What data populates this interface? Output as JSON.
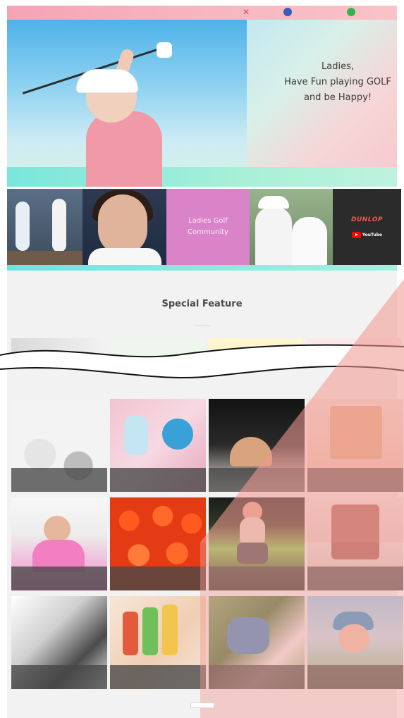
{
  "topbar": {
    "logo": "",
    "social": [
      {
        "name": "X",
        "label": ""
      },
      {
        "name": "Facebook",
        "label": ""
      },
      {
        "name": "LINE",
        "label": ""
      }
    ]
  },
  "hero": {
    "title_lines": [
      "Ladies,",
      "Have Fun playing GOLF",
      "and be Happy!"
    ],
    "description": ""
  },
  "banners": {
    "ladies_golf": "Ladies Golf\nCommunity",
    "dunlop_logo": "DUNLOP",
    "dunlop_sub": "",
    "youtube_label": "YouTube"
  },
  "special_feature": {
    "title": "Special Feature",
    "top_thumbs": [
      "",
      "",
      "",
      ""
    ],
    "grid_subtitle": ""
  },
  "grid": {
    "selected_index": 6,
    "cards": [
      {
        "c1": "",
        "c2": ""
      },
      {
        "c1": "",
        "c2": ""
      },
      {
        "c1": "",
        "c2": ""
      },
      {
        "c1": "",
        "c2": ""
      },
      {
        "c1": "",
        "c2": ""
      },
      {
        "c1": "",
        "c2": ""
      },
      {
        "c1": "",
        "c2": ""
      },
      {
        "c1": "",
        "c2": ""
      },
      {
        "c1": "",
        "c2": ""
      },
      {
        "c1": "",
        "c2": ""
      },
      {
        "c1": "",
        "c2": ""
      },
      {
        "c1": "",
        "c2": ""
      }
    ]
  },
  "footer": {
    "more_label": "",
    "bottom_note": ""
  },
  "colors": {
    "topbar_pink": "#f6a3b6",
    "accent_red": "#e21b2a",
    "section_bg": "#f2f2f2",
    "strip_teal": "#6fe3e0"
  }
}
